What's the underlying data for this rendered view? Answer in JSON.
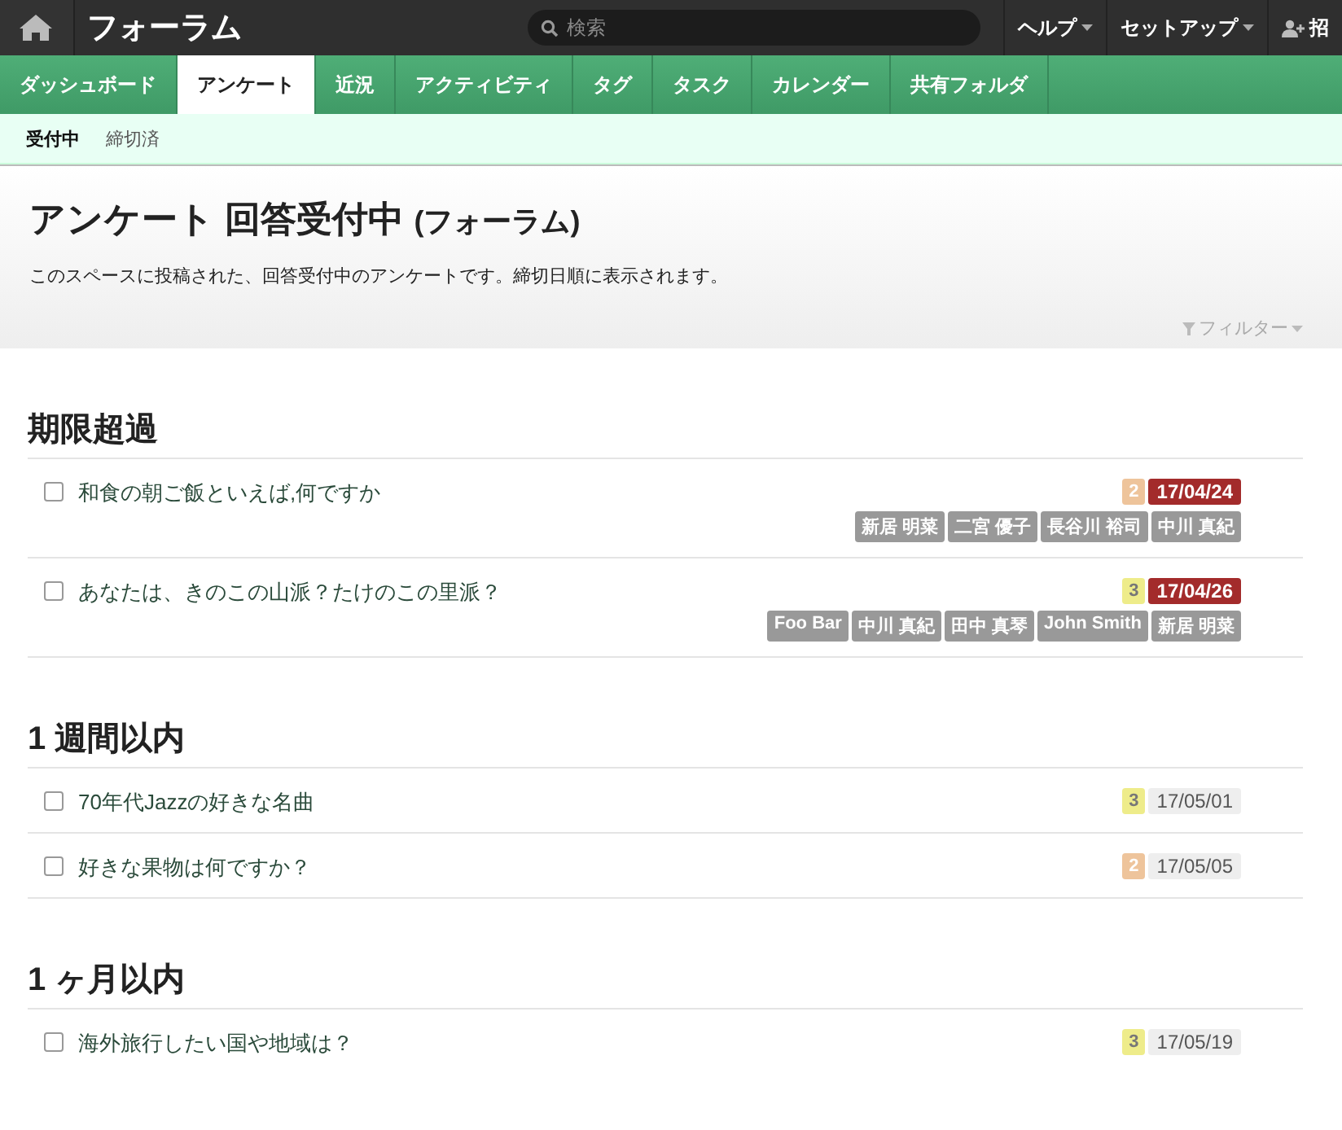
{
  "topbar": {
    "title": "フォーラム",
    "search": {
      "placeholder": "検索"
    },
    "menus": [
      {
        "label": "ヘルプ",
        "dropdown": true
      },
      {
        "label": "セットアップ",
        "dropdown": true
      },
      {
        "label": "招",
        "dropdown": false
      }
    ]
  },
  "tabs": [
    {
      "label": "ダッシュボード",
      "selected": false
    },
    {
      "label": "アンケート",
      "selected": true
    },
    {
      "label": "近況",
      "selected": false
    },
    {
      "label": "アクティビティ",
      "selected": false
    },
    {
      "label": "タグ",
      "selected": false
    },
    {
      "label": "タスク",
      "selected": false
    },
    {
      "label": "カレンダー",
      "selected": false
    },
    {
      "label": "共有フォルダ",
      "selected": false
    }
  ],
  "subtabs": [
    {
      "label": "受付中",
      "selected": true
    },
    {
      "label": "締切済",
      "selected": false
    }
  ],
  "header": {
    "title": "アンケート 回答受付中",
    "space": "(フォーラム)",
    "description": "このスペースに投稿された、回答受付中のアンケートです。締切日順に表示されます。",
    "filter": "フィルター"
  },
  "sections": [
    {
      "title": "期限超過",
      "items": [
        {
          "title": "和食の朝ご飯といえば,何ですか",
          "checked": false,
          "count": "2",
          "color": "#eec49b",
          "date": "17/04/24",
          "overdue": true,
          "people": [
            "新居 明菜",
            "二宮 優子",
            "長谷川 裕司",
            "中川 真紀"
          ]
        },
        {
          "title": "あなたは、きのこの山派？たけのこの里派？",
          "checked": false,
          "count": "3",
          "color": "#eeec8a",
          "date": "17/04/26",
          "overdue": true,
          "people": [
            "Foo Bar",
            "中川 真紀",
            "田中 真琴",
            "John Smith",
            "新居 明菜"
          ]
        }
      ]
    },
    {
      "title": "1 週間以内",
      "items": [
        {
          "title": "70年代Jazzの好きな名曲",
          "checked": false,
          "count": "3",
          "color": "#eeec8a",
          "date": "17/05/01",
          "overdue": false
        },
        {
          "title": "好きな果物は何ですか？",
          "checked": false,
          "count": "2",
          "color": "#eec49b",
          "date": "17/05/05",
          "overdue": false
        }
      ]
    },
    {
      "title": "1 ヶ月以内",
      "items": [
        {
          "title": "海外旅行したい国や地域は？",
          "checked": false,
          "count": "3",
          "color": "#eeec8a",
          "date": "17/05/19",
          "overdue": false
        }
      ]
    }
  ]
}
